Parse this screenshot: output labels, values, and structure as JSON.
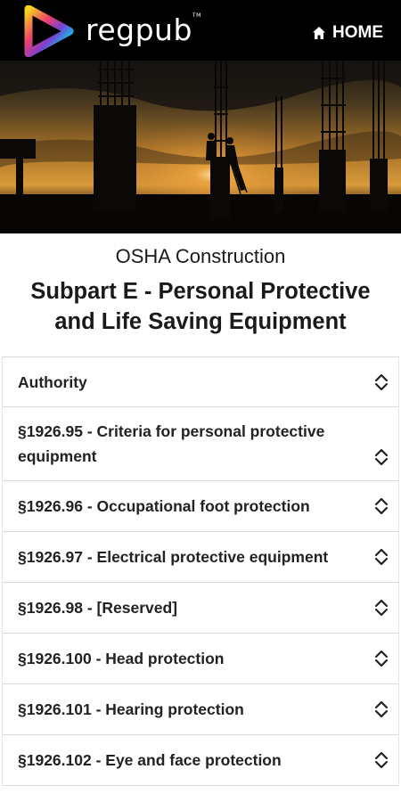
{
  "header": {
    "brand": "regpub",
    "brand_mark": "TM",
    "home_label": "HOME",
    "logo_icon": "play-triangle-logo",
    "home_icon": "house-icon"
  },
  "hero": {
    "description_icon": "construction-silhouette-image"
  },
  "page": {
    "subtitle": "OSHA Construction",
    "title": "Subpart E - Personal Protective and Life Saving Equipment"
  },
  "sections": [
    {
      "label": "Authority"
    },
    {
      "label": "§1926.95 - Criteria for personal protective equipment"
    },
    {
      "label": "§1926.96 - Occupational foot protection"
    },
    {
      "label": "§1926.97 - Electrical protective equipment"
    },
    {
      "label": "§1926.98 - [Reserved]"
    },
    {
      "label": "§1926.100 - Head protection"
    },
    {
      "label": "§1926.101 - Hearing protection"
    },
    {
      "label": "§1926.102 - Eye and face protection"
    }
  ],
  "colors": {
    "topbar": "#000000",
    "logo_gradient": [
      "#f7d51d",
      "#ee3f6b",
      "#7a3fd1",
      "#1db0e6",
      "#40c463"
    ],
    "divider": "#d9d9d9"
  }
}
